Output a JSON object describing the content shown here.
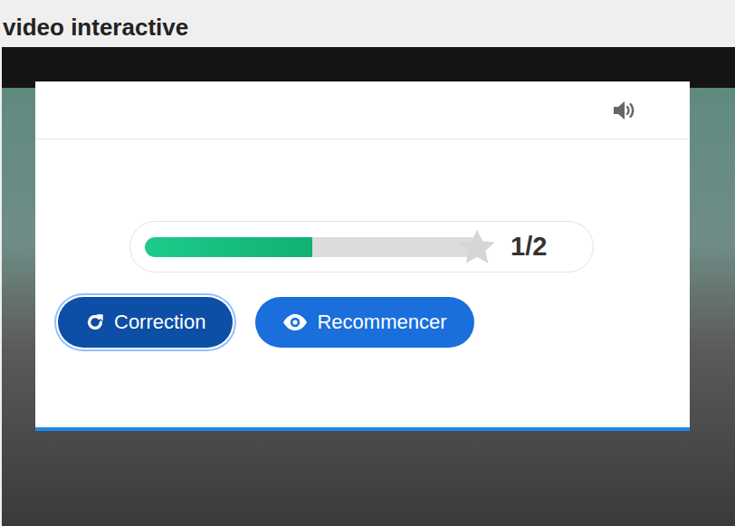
{
  "page": {
    "title": "video interactive"
  },
  "score": {
    "text": "1/2",
    "level": 0.5
  },
  "buttons": [
    {
      "label": "Correction",
      "focused": true,
      "kind": "redo"
    },
    {
      "label": "Recommencer",
      "focused": false,
      "kind": "view"
    }
  ]
}
